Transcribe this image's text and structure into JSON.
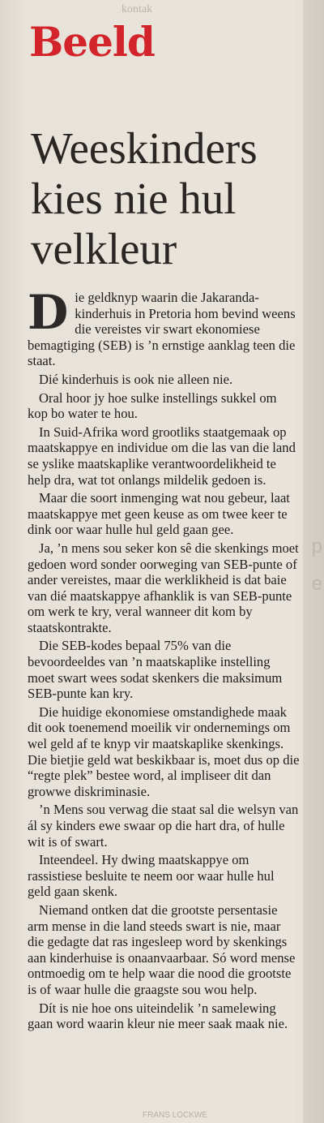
{
  "page": {
    "top_scrap_text": "kontak",
    "byline_fragment": "FRANS LOCKWE"
  },
  "section_label": "Beeld",
  "headline": {
    "line1": "Weeskinders",
    "line2": "kies nie hul",
    "line3": "velkleur"
  },
  "article": {
    "dropcap": "D",
    "paragraphs": [
      "ie geldknyp waarin die Jakaranda-kinderhuis in Pretoria hom bevind weens die vereistes vir swart ekonomiese bemagtiging (SEB) is ’n ernstige aanklag teen die staat.",
      "Dié kinderhuis is ook nie alleen nie.",
      "Oral hoor jy hoe sulke instellings sukkel om kop bo water te hou.",
      "In Suid-Afrika word grootliks staatgemaak op maatskappye en individue om die las van die land se yslike maatskaplike verantwoordelikheid te help dra, wat tot onlangs mildelik gedoen is.",
      "Maar die soort inmenging wat nou gebeur, laat maatskappye met geen keuse as om twee keer te dink oor waar hulle hul geld gaan gee.",
      "Ja, ’n mens sou seker kon sê die skenkings moet gedoen word sonder oorweging van SEB-punte of ander vereistes, maar die werklikheid is dat baie van dié maatskappye afhanklik is van SEB-punte om werk te kry, veral wanneer dit kom by staatskontrakte.",
      "Die SEB-kodes bepaal 75% van die bevoordeeldes van ’n maatskaplike instelling moet swart wees sodat skenkers die maksimum SEB-punte kan kry.",
      "Die huidige ekonomiese omstandighede maak dit ook toenemend moeilik vir ondernemings om wel geld af te knyp vir maatskaplike skenkings. Die bietjie geld wat beskikbaar is, moet dus op die “regte plek” bestee word, al impliseer dit dan growwe diskriminasie.",
      "’n Mens sou verwag die staat sal die welsyn van ál sy kinders ewe swaar op die hart dra, of hulle wit is of swart.",
      "Inteendeel. Hy dwing maatskappye om rassistiese besluite te neem oor waar hulle hul geld gaan skenk.",
      "Niemand ontken dat die grootste persentasie arm mense in die land steeds swart is nie, maar die gedagte dat ras ingesleep word by skenkings aan kinderhuise is onaanvaarbaar. Só word mense ontmoedig om te help waar die nood die grootste is of waar hulle die graagste sou wou help.",
      "Dít is nie hoe ons uiteindelik ’n samelewing gaan word waarin kleur nie meer saak maak nie."
    ]
  }
}
